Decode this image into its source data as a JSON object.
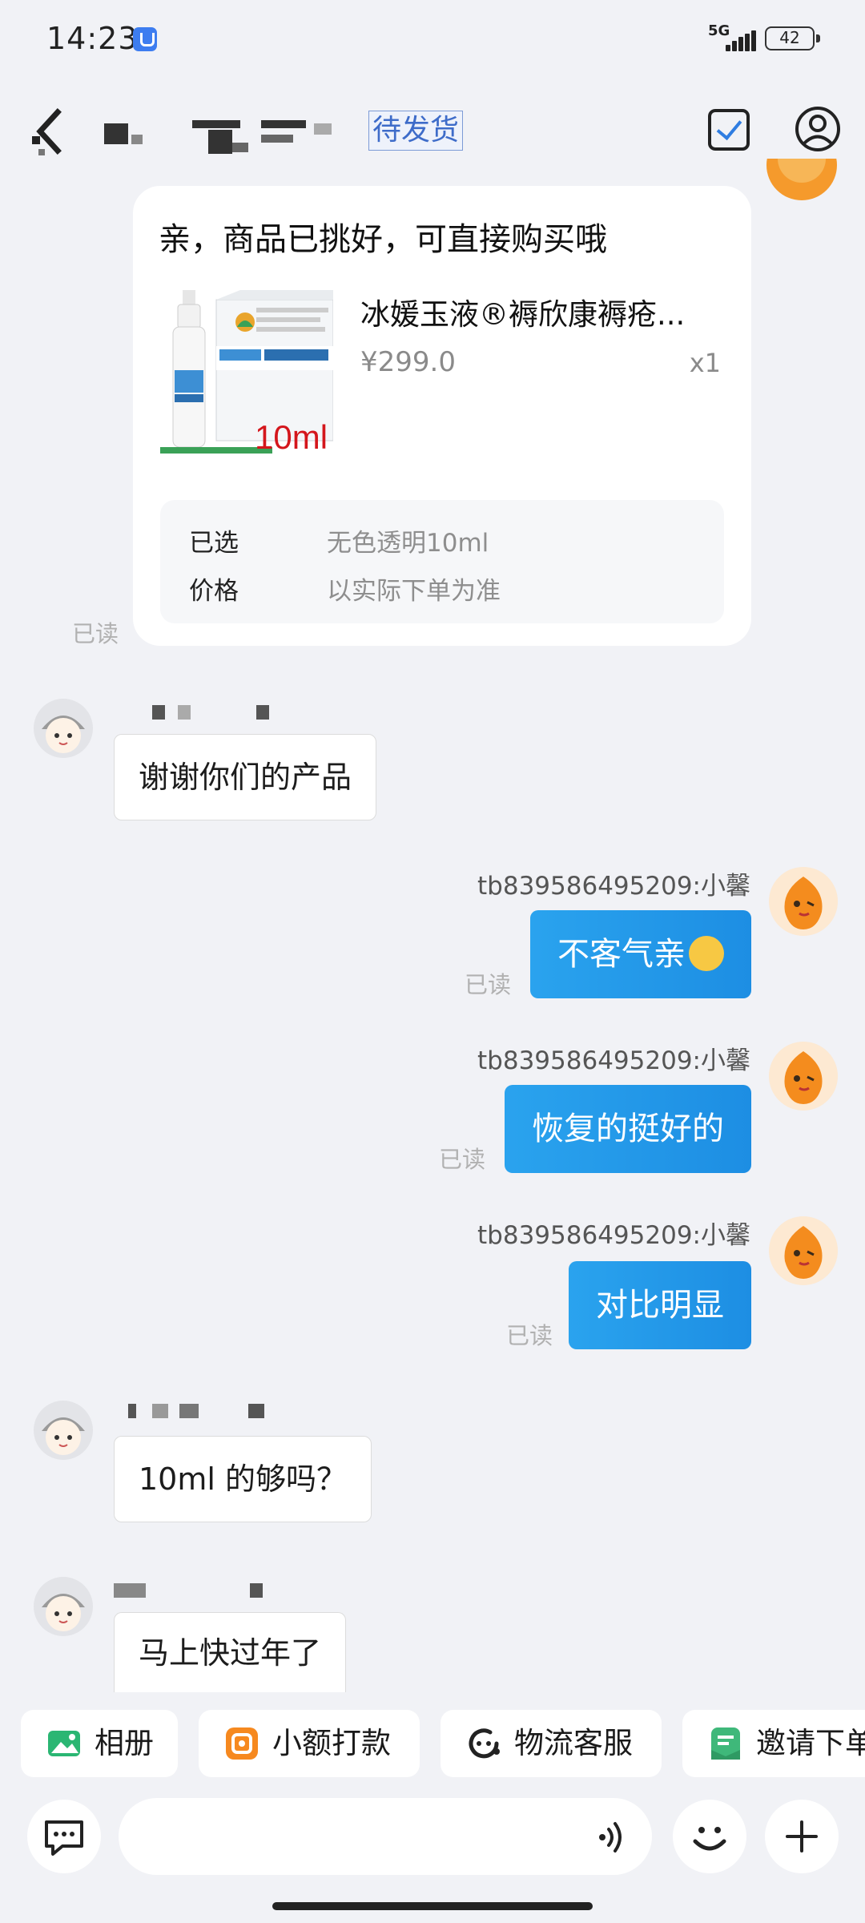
{
  "status_bar": {
    "time": "14:23",
    "network": "5G",
    "battery": "42"
  },
  "header": {
    "order_status": "待发货"
  },
  "product_card": {
    "title": "亲，商品已挑好，可直接购买哦",
    "product_name": "冰媛玉液®褥欣康褥疮...",
    "price": "¥299.0",
    "quantity": "x1",
    "image_caption": "10ml",
    "specs": [
      {
        "label": "已选",
        "value": "无色透明10ml"
      },
      {
        "label": "价格",
        "value": "以实际下单为准"
      }
    ],
    "read_status": "已读"
  },
  "messages": [
    {
      "side": "customer",
      "text": "谢谢你们的产品"
    },
    {
      "side": "agent",
      "sender": "tb839586495209:小馨",
      "text": "不客气亲",
      "read_status": "已读"
    },
    {
      "side": "agent",
      "sender": "tb839586495209:小馨",
      "text": "恢复的挺好的",
      "read_status": "已读"
    },
    {
      "side": "agent",
      "sender": "tb839586495209:小馨",
      "text": "对比明显",
      "read_status": "已读"
    },
    {
      "side": "customer",
      "text": "10ml 的够吗？"
    },
    {
      "side": "customer",
      "text": "马上快过年了"
    }
  ],
  "quick_actions": [
    {
      "label": "相册",
      "icon": "photo-album-icon",
      "color": "#2bb673"
    },
    {
      "label": "小额打款",
      "icon": "payment-icon",
      "color": "#f6891f"
    },
    {
      "label": "物流客服",
      "icon": "logistics-service-icon",
      "color": "#222222"
    },
    {
      "label": "邀请下单",
      "icon": "invite-order-icon",
      "color": "#3fb87a"
    }
  ],
  "input_bar": {
    "placeholder": ""
  },
  "colors": {
    "accent_blue": "#1d8ee3",
    "background": "#f1f2f6",
    "tag_blue": "#3e6cc9"
  }
}
